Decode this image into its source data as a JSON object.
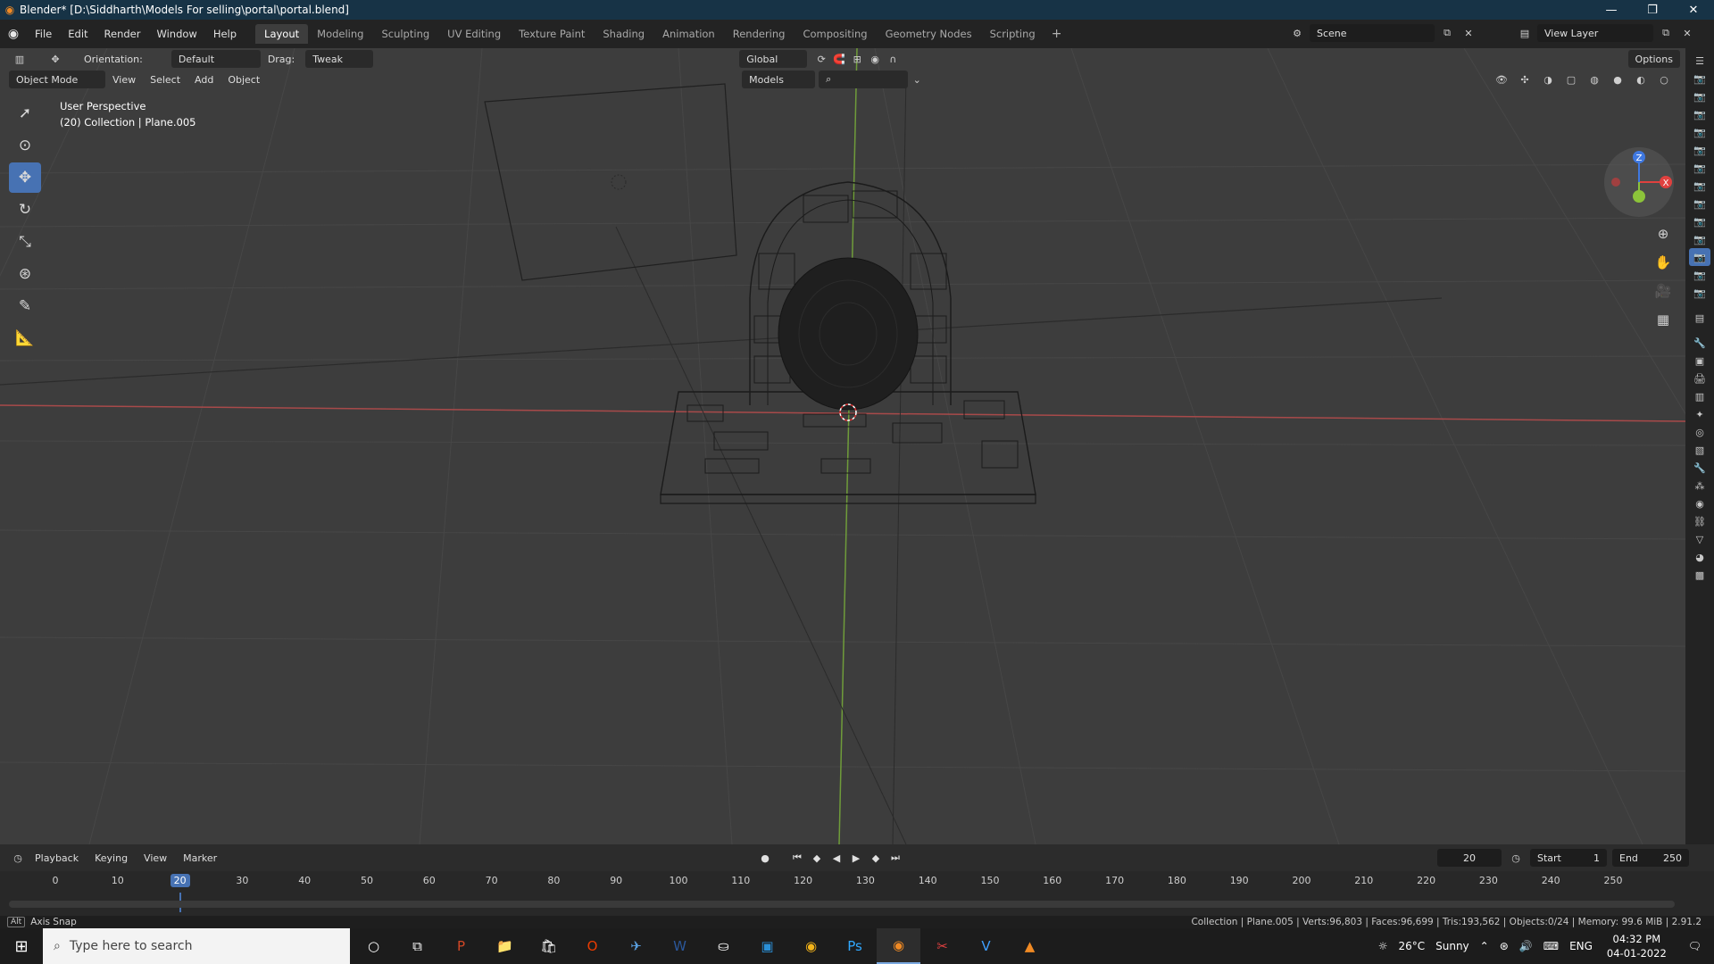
{
  "window": {
    "title": "Blender* [D:\\Siddharth\\Models For selling\\portal\\portal.blend]",
    "app_icon": "blender-icon",
    "controls": [
      "minimize-icon",
      "restore-icon",
      "close-icon"
    ]
  },
  "menu": [
    "File",
    "Edit",
    "Render",
    "Window",
    "Help"
  ],
  "workspaces": [
    "Layout",
    "Modeling",
    "Sculpting",
    "UV Editing",
    "Texture Paint",
    "Shading",
    "Animation",
    "Rendering",
    "Compositing",
    "Geometry Nodes",
    "Scripting"
  ],
  "active_workspace": "Layout",
  "scene": {
    "name": "Scene",
    "view_layer": "View Layer"
  },
  "viewport_header": {
    "orientation_label": "Orientation:",
    "orientation_value": "Default",
    "drag_label": "Drag:",
    "drag_value": "Tweak",
    "transform_orientation": "Global",
    "options": "Options",
    "mode": "Object Mode",
    "menus": [
      "View",
      "Select",
      "Add",
      "Object"
    ],
    "collection_filter": "Models",
    "search_placeholder": ""
  },
  "viewport": {
    "perspective": "User Perspective",
    "context": "(20) Collection | Plane.005",
    "gizmo_axes": {
      "x": "X",
      "y": "Y",
      "z": "Z"
    },
    "axis_colors": {
      "x": "#e0413f",
      "y": "#8cc33a",
      "z": "#3f78e0"
    }
  },
  "tools": [
    "select-box-icon",
    "cursor-icon",
    "move-icon",
    "rotate-icon",
    "scale-icon",
    "transform-icon",
    "annotate-icon",
    "measure-icon"
  ],
  "active_tool": "move-icon",
  "timeline": {
    "menus": [
      "Playback",
      "Keying",
      "View",
      "Marker"
    ],
    "current_frame": "20",
    "start_label": "Start",
    "start": "1",
    "end_label": "End",
    "end": "250",
    "ticks": [
      "0",
      "10",
      "20",
      "30",
      "40",
      "50",
      "60",
      "70",
      "80",
      "90",
      "100",
      "110",
      "120",
      "130",
      "140",
      "150",
      "160",
      "170",
      "180",
      "190",
      "200",
      "210",
      "220",
      "230",
      "240",
      "250"
    ]
  },
  "statusbar": {
    "hint_key": "Alt",
    "hint": "Axis Snap",
    "stats": "Collection | Plane.005 | Verts:96,803 | Faces:96,699 | Tris:193,562 | Objects:0/24 | Memory: 99.6 MiB | 2.91.2"
  },
  "taskbar": {
    "search_placeholder": "Type here to search",
    "weather_temp": "26°C",
    "weather_text": "Sunny",
    "lang": "ENG",
    "time": "04:32 PM",
    "date": "04-01-2022"
  }
}
